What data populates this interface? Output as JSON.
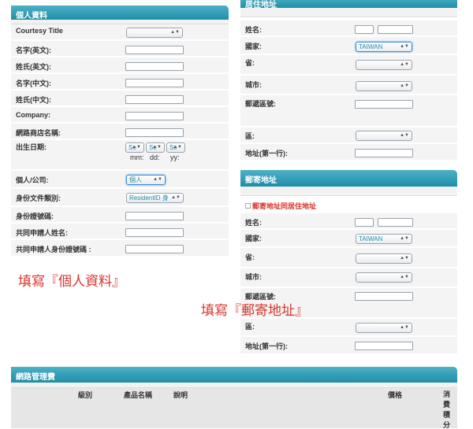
{
  "personal": {
    "header": "個人資料",
    "fields": [
      {
        "label": "Courtesy Title"
      },
      {
        "label": "名字(英文):"
      },
      {
        "label": "姓氏(英文):"
      },
      {
        "label": "名字(中文):"
      },
      {
        "label": "姓氏(中文):"
      },
      {
        "label": "Company:"
      },
      {
        "label": "網路商店名稱:"
      },
      {
        "label": "出生日期:"
      },
      {
        "label": "個人/公司:"
      },
      {
        "label": "身份文件類別:"
      },
      {
        "label": "身份證號碼:"
      },
      {
        "label": "共同申請人姓名:"
      },
      {
        "label": "共同申請人身份證號碼 :"
      }
    ],
    "dob_selects": [
      "Se",
      "Se",
      "Se"
    ],
    "dob_labels": {
      "mm": "mm:",
      "dd": "dd:",
      "yy": "yy:"
    },
    "entity_value": "個人",
    "id_type_value": "ResidentID 身"
  },
  "residence": {
    "header": "居住地址",
    "fields": {
      "name": "姓名:",
      "country": "國家:",
      "province": "省:",
      "city": "城市:",
      "postal": "郵遞區號:",
      "district": "區:",
      "address": "地址(第一行):"
    },
    "country_value": "TAIWAN"
  },
  "mailing": {
    "header": "郵寄地址",
    "same_checkbox_label": "郵寄地址同居住地址",
    "fields": {
      "name": "姓名:",
      "country": "國家:",
      "province": "省:",
      "city": "城市:",
      "postal": "郵遞區號:",
      "district": "區:",
      "address": "地址(第一行):"
    },
    "country_value": "TAIWAN"
  },
  "annotations": {
    "personal": "填寫『個人資料』",
    "mailing": "填寫『郵寄地址』"
  },
  "fees": {
    "header": "網路管理費",
    "columns": [
      "級別",
      "產品名稱",
      "說明",
      "價格",
      "消費積分"
    ]
  }
}
